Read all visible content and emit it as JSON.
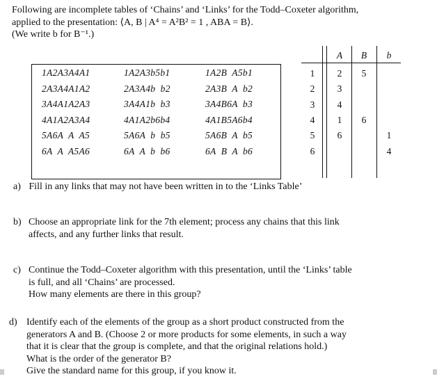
{
  "intro": {
    "line1": "Following are incomplete tables of ‘Chains’ and ‘Links’ for the Todd–Coxeter algorithm,",
    "line2": "applied to the presentation: ⟨A, B | A⁴ = A²B² = 1 , ABA = B⟩.",
    "line3": "(We write b for B⁻¹.)"
  },
  "chains": [
    [
      "1A2A3A4A1",
      "1A2A3b5b1",
      "1A2B  A5b1"
    ],
    [
      "2A3A4A1A2",
      "2A3A4b  b2",
      "2A3B  A  b2"
    ],
    [
      "3A4A1A2A3",
      "3A4A1b  b3",
      "3A4B6A  b3"
    ],
    [
      "4A1A2A3A4",
      "4A1A2b6b4",
      "4A1B5A6b4"
    ],
    [
      "5A6A  A  A5",
      "5A6A  b  b5",
      "5A6B  A  b5"
    ],
    [
      "6A  A  A5A6",
      "6A  A  b  b6",
      "6A  B  A  b6"
    ]
  ],
  "links": {
    "headers": [
      "A",
      "B",
      "b"
    ],
    "rows": [
      {
        "el": "1",
        "A": "2",
        "B": "5",
        "b": ""
      },
      {
        "el": "2",
        "A": "3",
        "B": "",
        "b": ""
      },
      {
        "el": "3",
        "A": "4",
        "B": "",
        "b": ""
      },
      {
        "el": "4",
        "A": "1",
        "B": "6",
        "b": ""
      },
      {
        "el": "5",
        "A": "6",
        "B": "",
        "b": "1"
      },
      {
        "el": "6",
        "A": "",
        "B": "",
        "b": "4"
      }
    ]
  },
  "questions": {
    "a": {
      "label": "a)",
      "text": "Fill in any links that may not have been written in to the ‘Links Table’"
    },
    "b": {
      "label": "b)",
      "l1": "Choose an appropriate link for the 7th element; process any chains that this link",
      "l2": "affects, and any further links that result."
    },
    "c": {
      "label": "c)",
      "l1": "Continue the Todd–Coxeter algorithm with this presentation, until the ‘Links’ table",
      "l2": "is full, and all ‘Chains’ are processed.",
      "l3": "How many elements are there in this group?"
    },
    "d": {
      "label": "d)",
      "l1": "Identify each of the elements of the group as a short product constructed from the",
      "l2": "generators A and B. (Choose 2 or more products for some elements, in such a way",
      "l3": "that it is clear that the group is complete, and that the original relations hold.)",
      "l4": "What is the order of the generator B?",
      "l5": "Give the standard name for this group, if you know it."
    }
  }
}
